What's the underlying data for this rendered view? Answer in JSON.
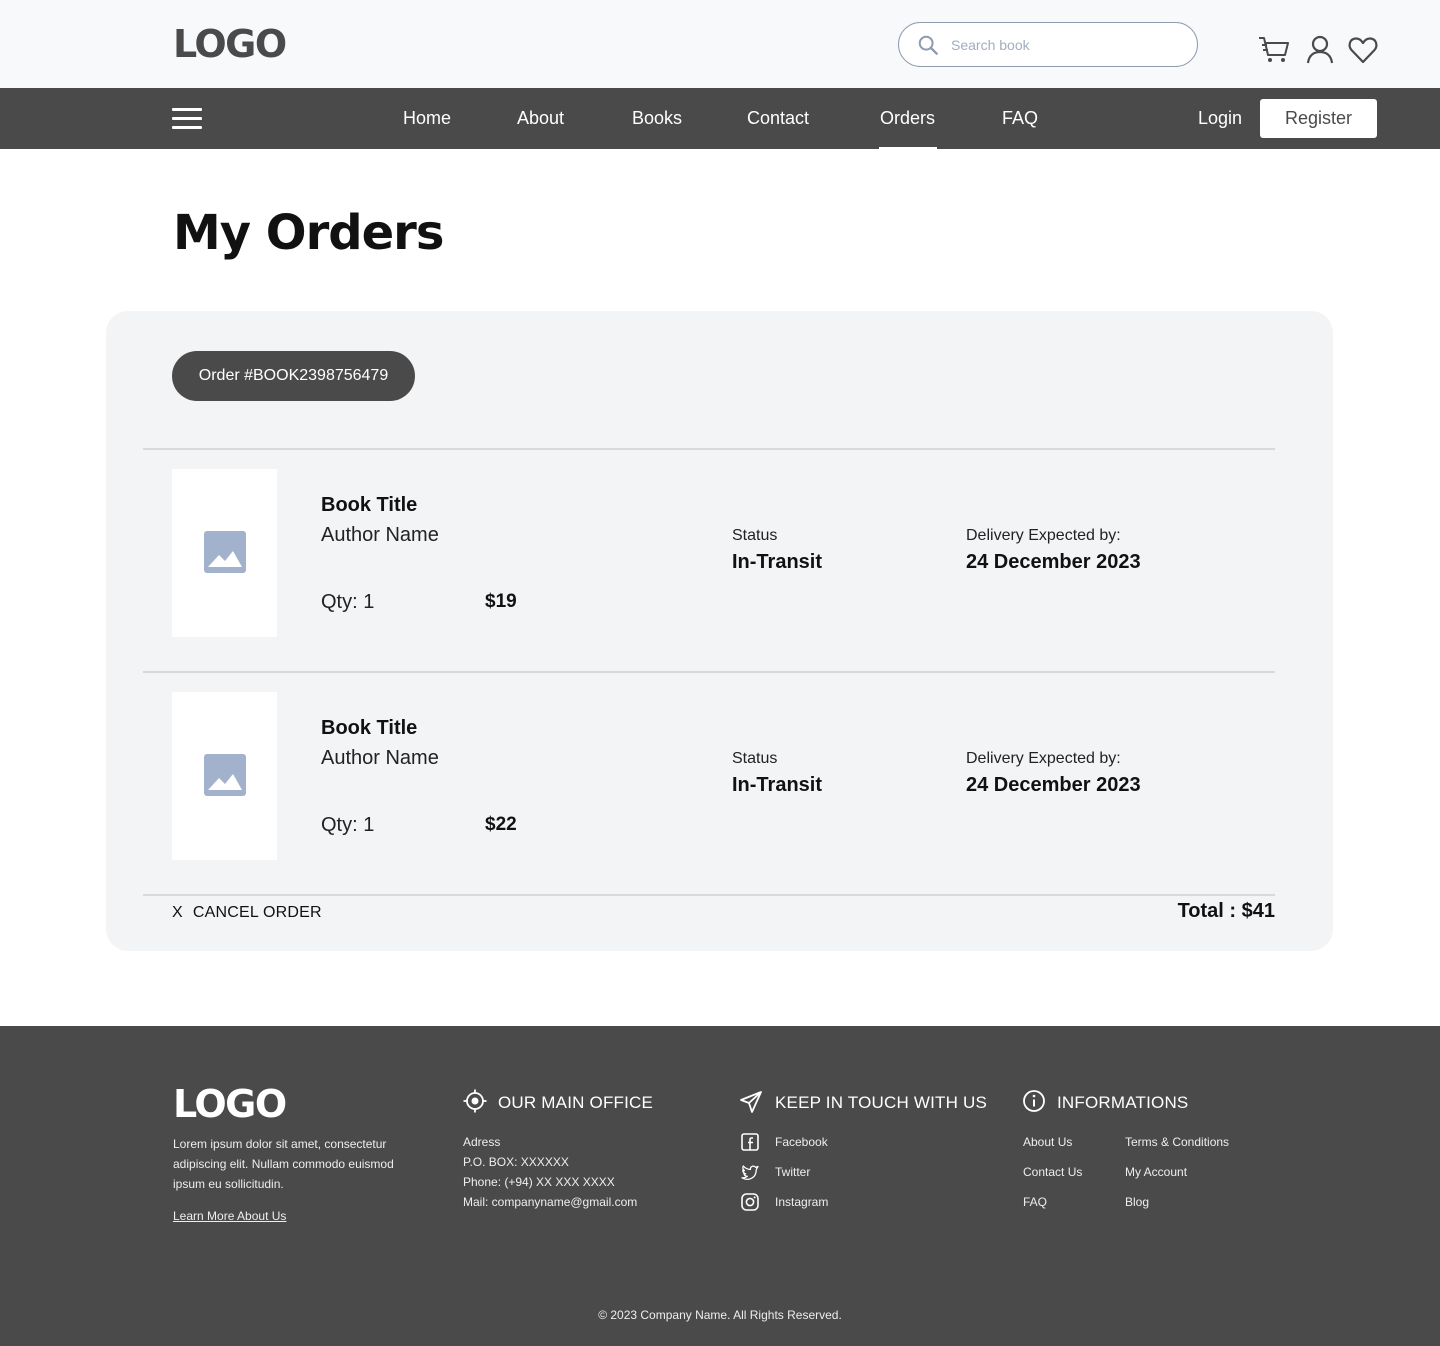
{
  "header": {
    "logo": "LOGO",
    "search_placeholder": "Search book",
    "icons": [
      "search-icon",
      "cart-icon",
      "user-icon",
      "heart-icon"
    ]
  },
  "nav": {
    "items": [
      {
        "label": "Home",
        "active": false
      },
      {
        "label": "About",
        "active": false
      },
      {
        "label": "Books",
        "active": false
      },
      {
        "label": "Contact",
        "active": false
      },
      {
        "label": "Orders",
        "active": true
      },
      {
        "label": "FAQ",
        "active": false
      }
    ],
    "login_label": "Login",
    "register_label": "Register"
  },
  "main": {
    "title": "My Orders",
    "order": {
      "id_label": "Order #BOOK2398756479",
      "items": [
        {
          "title": "Book Title",
          "author": "Author Name",
          "qty": "Qty: 1",
          "price": "$19",
          "status_label": "Status",
          "status": "In-Transit",
          "delivery_label": "Delivery Expected by:",
          "delivery_date": "24 December 2023"
        },
        {
          "title": "Book Title",
          "author": "Author Name",
          "qty": "Qty: 1",
          "price": "$22",
          "status_label": "Status",
          "status": "In-Transit",
          "delivery_label": "Delivery Expected by:",
          "delivery_date": "24 December 2023"
        }
      ],
      "cancel_x": "X",
      "cancel_label": "CANCEL ORDER",
      "total": "Total : $41"
    }
  },
  "footer": {
    "logo": "LOGO",
    "about_text": "Lorem ipsum dolor sit amet, consectetur adipiscing elit. Nullam commodo euismod ipsum eu sollicitudin.",
    "learn_more": "Learn More About Us",
    "office": {
      "heading": "OUR MAIN OFFICE",
      "lines": [
        "Adress",
        "P.O. BOX: XXXXXX",
        "Phone: (+94) XX XXX XXXX",
        "Mail: companyname@gmail.com"
      ]
    },
    "social": {
      "heading": "KEEP IN TOUCH WITH US",
      "links": [
        {
          "label": "Facebook",
          "icon": "facebook-icon"
        },
        {
          "label": "Twitter",
          "icon": "twitter-icon"
        },
        {
          "label": "Instagram",
          "icon": "instagram-icon"
        }
      ]
    },
    "info": {
      "heading": "INFORMATIONS",
      "col1": [
        "About Us",
        "Contact Us",
        "FAQ"
      ],
      "col2": [
        "Terms & Conditions",
        "My Account",
        "Blog"
      ]
    },
    "copyright": "© 2023 Company Name. All Rights Reserved."
  }
}
